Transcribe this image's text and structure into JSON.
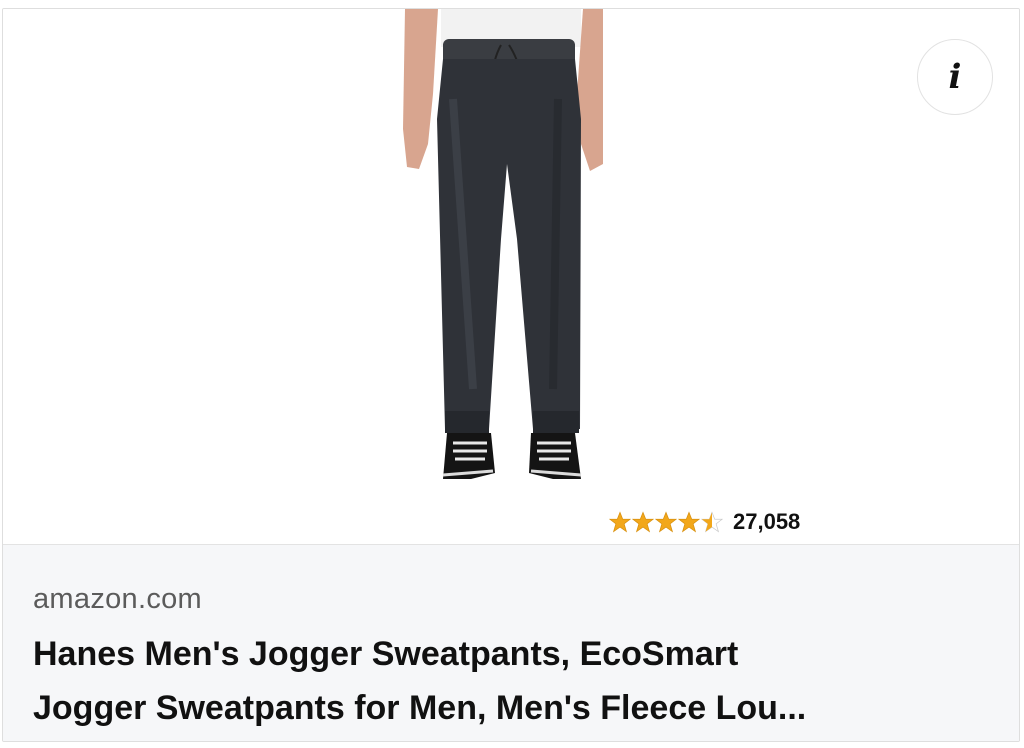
{
  "card": {
    "info_icon_glyph": "i",
    "rating": {
      "stars": 4.5,
      "count": "27,058",
      "star_color": "#f2a71a"
    },
    "source": "amazon.com",
    "title_lines": [
      "Hanes Men's Jogger Sweatpants, EcoSmart",
      "Jogger Sweatpants for Men, Men's Fleece Lou..."
    ]
  }
}
